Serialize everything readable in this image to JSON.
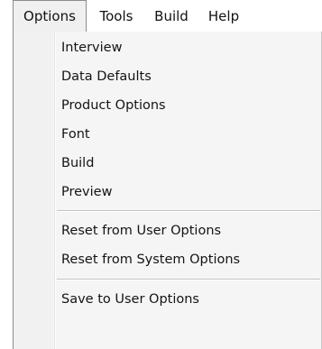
{
  "menubar": {
    "items": [
      {
        "label": "Options",
        "active": true
      },
      {
        "label": "Tools",
        "active": false
      },
      {
        "label": "Build",
        "active": false
      },
      {
        "label": "Help",
        "active": false
      }
    ]
  },
  "options_menu": {
    "groups": [
      [
        "Interview",
        "Data Defaults",
        "Product Options",
        "Font",
        "Build",
        "Preview"
      ],
      [
        "Reset from User Options",
        "Reset from System Options"
      ],
      [
        "Save to User Options"
      ]
    ],
    "items": [
      {
        "label": "Interview"
      },
      {
        "label": "Data Defaults"
      },
      {
        "label": "Product Options"
      },
      {
        "label": "Font"
      },
      {
        "label": "Build"
      },
      {
        "label": "Preview"
      },
      {
        "label": "Reset from User Options"
      },
      {
        "label": "Reset from System Options"
      },
      {
        "label": "Save to User Options"
      }
    ]
  }
}
